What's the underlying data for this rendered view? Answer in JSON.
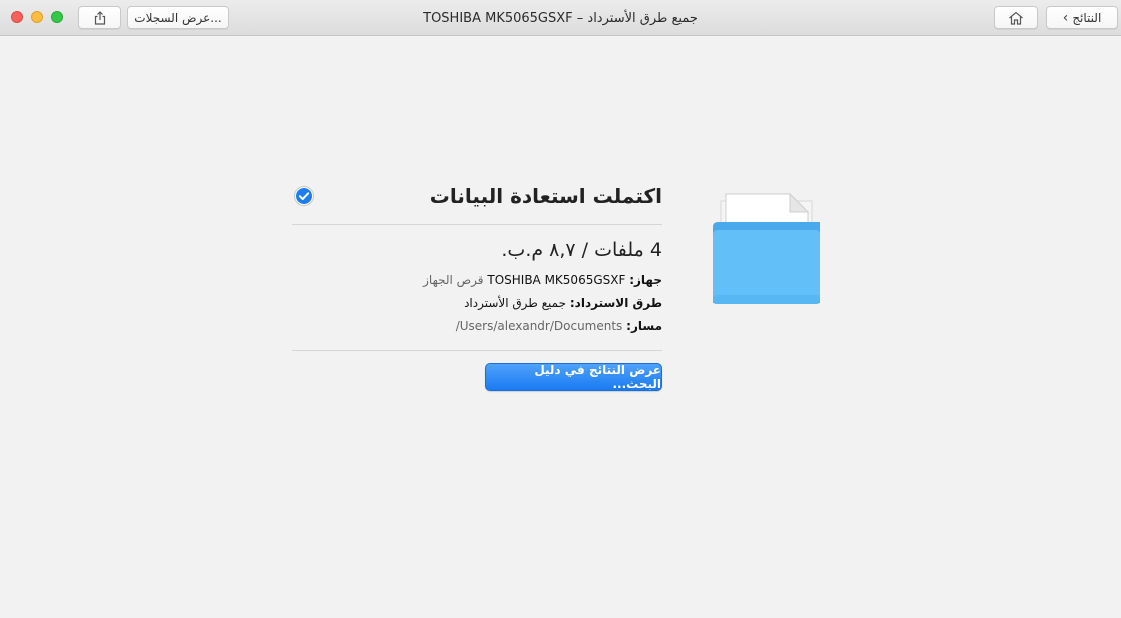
{
  "window": {
    "title": "جميع طرق الأسترداد – TOSHIBA MK5065GSXF"
  },
  "toolbar": {
    "logs_label": "عرض السجلات...",
    "back_label": "النتائج",
    "share_icon": "share-icon",
    "home_icon": "home-icon"
  },
  "result": {
    "heading": "اكتملت استعادة البيانات",
    "summary": "4 ملفات / ٨,٧ م.ب.",
    "device_label": "جهاز:",
    "device_value": "TOSHIBA MK5065GSXF",
    "device_kind": "قرص الجهاز",
    "method_label": "طرق الاسترداد:",
    "method_value": "جميع طرق الأسترداد",
    "path_label": "مسار:",
    "path_value": "/Users/alexandr/Documents",
    "show_button": "عرض النتائج في دليل البحث..."
  },
  "colors": {
    "accent": "#1a7bf1",
    "folder": "#5ab8f5",
    "check": "#1d7ef0"
  }
}
